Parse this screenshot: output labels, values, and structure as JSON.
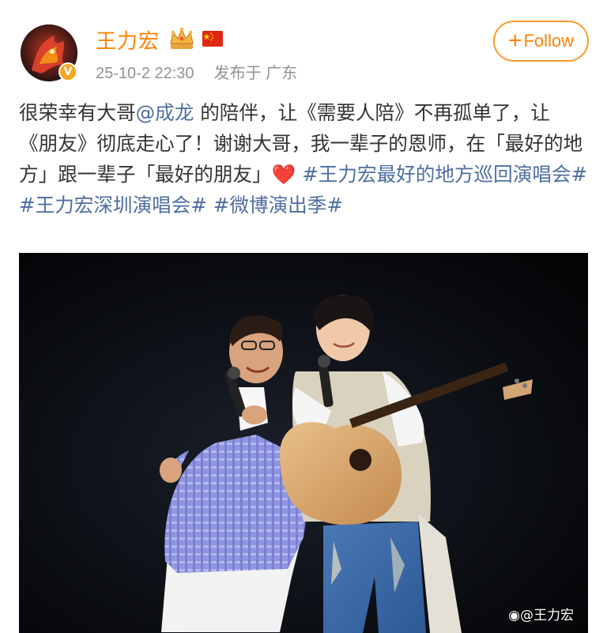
{
  "user": {
    "name": "王力宏",
    "badge_icon": "crown-icon",
    "flag_icon": "china-flag-icon",
    "verified_icon": "verified-v-icon",
    "verified_mark": "V"
  },
  "meta": {
    "time": "25-10-2 22:30",
    "location": "发布于 广东"
  },
  "follow_button": {
    "plus": "+",
    "label": "Follow"
  },
  "post": {
    "seg1": "很荣幸有大哥",
    "mention": "@成龙",
    "seg2": " 的陪伴，让《需要人陪》不再孤单了，让《朋友》彻底走心了！谢谢大哥，我一辈子的恩师，在「最好的地方」跟一辈子「最好的朋友」",
    "heart": "❤️",
    "tag1": "#王力宏最好的地方巡回演唱会#",
    "tag2": "#王力宏深圳演唱会#",
    "tag3": "#微博演出季#"
  },
  "photo": {
    "watermark": "@王力宏"
  },
  "colors": {
    "brand_orange": "#ff8200",
    "link_blue": "#4e6ea1",
    "text": "#333333",
    "meta_gray": "#939393"
  }
}
